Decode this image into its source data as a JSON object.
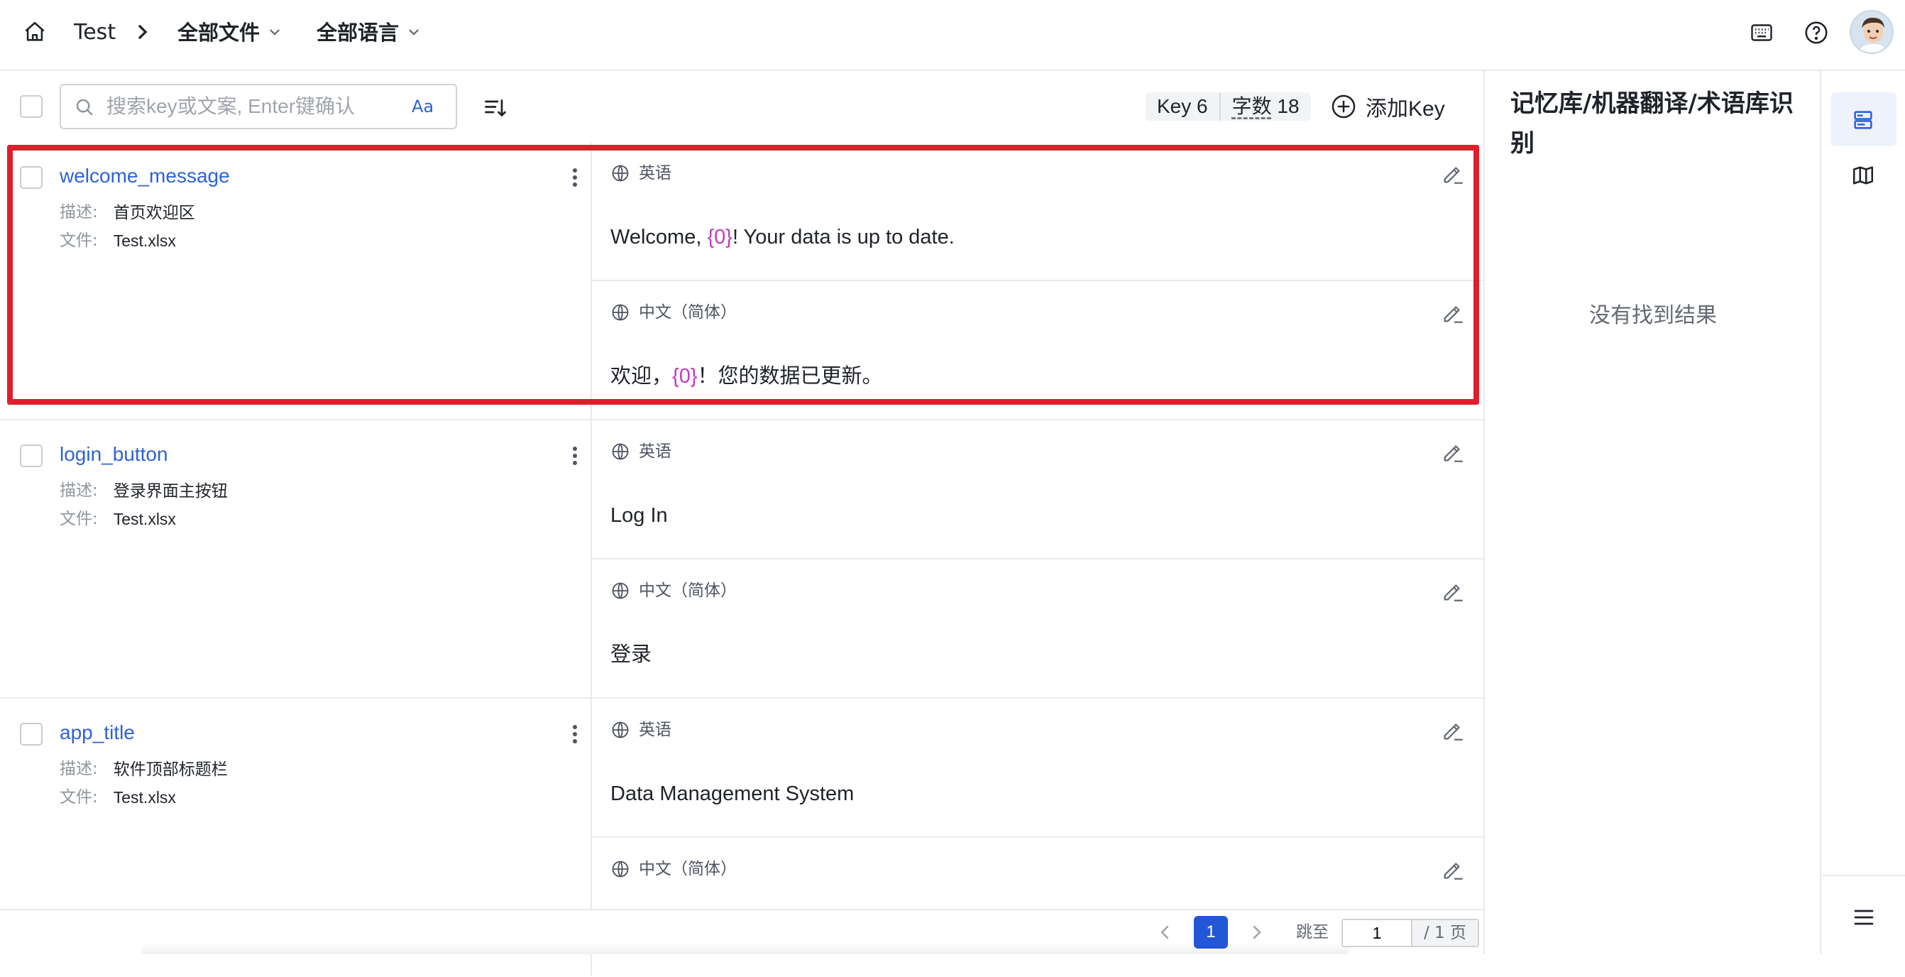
{
  "header": {
    "project": "Test",
    "file_filter": "全部文件",
    "lang_filter": "全部语言",
    "icons": [
      "home-icon",
      "chevron-right-icon",
      "chevron-down-icon",
      "keyboard-icon",
      "help-icon",
      "avatar"
    ]
  },
  "toolbar": {
    "search_placeholder": "搜索key或文案, Enter键确认",
    "case_toggle": "Aa",
    "stats_keys": "Key 6",
    "stats_words_label": "字数",
    "stats_words_value": "18",
    "add_key_label": "添加Key"
  },
  "labels": {
    "desc": "描述:",
    "file": "文件:"
  },
  "rows": [
    {
      "key": "welcome_message",
      "desc": "首页欢迎区",
      "file": "Test.xlsx",
      "highlighted": true,
      "translations": [
        {
          "lang": "英语",
          "pre": "Welcome, ",
          "placeholder": "{0}",
          "post": "! Your data is up to date."
        },
        {
          "lang": "中文（简体）",
          "pre": "欢迎，",
          "placeholder": "{0}",
          "post": "！您的数据已更新。"
        }
      ]
    },
    {
      "key": "login_button",
      "desc": "登录界面主按钮",
      "file": "Test.xlsx",
      "translations": [
        {
          "lang": "英语",
          "text": "Log In"
        },
        {
          "lang": "中文（简体）",
          "text": "登录"
        }
      ]
    },
    {
      "key": "app_title",
      "desc": "软件顶部标题栏",
      "file": "Test.xlsx",
      "translations": [
        {
          "lang": "英语",
          "text": "Data Management System"
        },
        {
          "lang": "中文（简体）",
          "text": ""
        }
      ]
    }
  ],
  "pagination": {
    "current": "1",
    "goto_label": "跳至",
    "goto_value": "1",
    "total": "/ 1 页"
  },
  "right_panel": {
    "title": "记忆库/机器翻译/术语库识别",
    "empty": "没有找到结果"
  },
  "colors": {
    "accent": "#2f62d6",
    "placeholder_token": "#c03ac4",
    "highlight": "#e11d2b",
    "page_active": "#2356d6"
  }
}
